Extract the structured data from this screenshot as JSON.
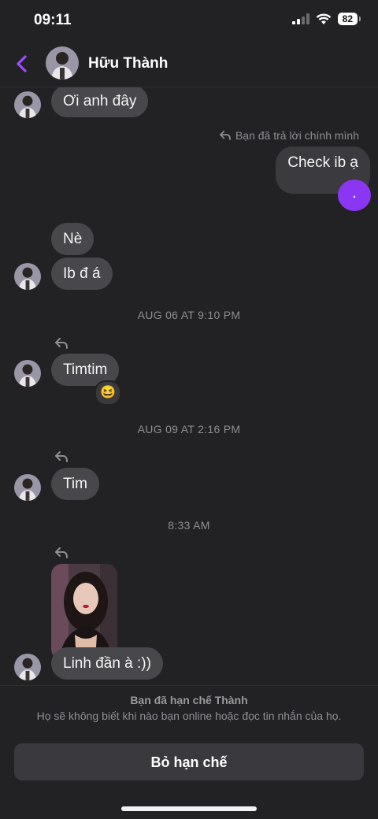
{
  "status_bar": {
    "time": "09:11",
    "battery": "82"
  },
  "header": {
    "name": "Hữu Thành"
  },
  "messages": {
    "m1": "Ơi anh đây",
    "reply_note": "Bạn đã trả lời chính mình",
    "m2": "Check ib ạ",
    "dot": ".",
    "m3": "Nè",
    "m4": "Ib đ á",
    "ts1": "AUG 06 AT 9:10 PM",
    "m5": "Timtim",
    "reaction": "😆",
    "ts2": "AUG 09 AT 2:16 PM",
    "m6": "Tim",
    "ts3": "8:33 AM",
    "m7": "Linh đần à :))"
  },
  "footer": {
    "title": "Bạn đã hạn chế Thành",
    "desc": "Họ sẽ không biết khi nào bạn online hoặc đọc tin nhắn của họ.",
    "button": "Bỏ hạn chế"
  },
  "colors": {
    "accent": "#8a36f2",
    "background": "#222225",
    "bubble": "#48484c"
  }
}
